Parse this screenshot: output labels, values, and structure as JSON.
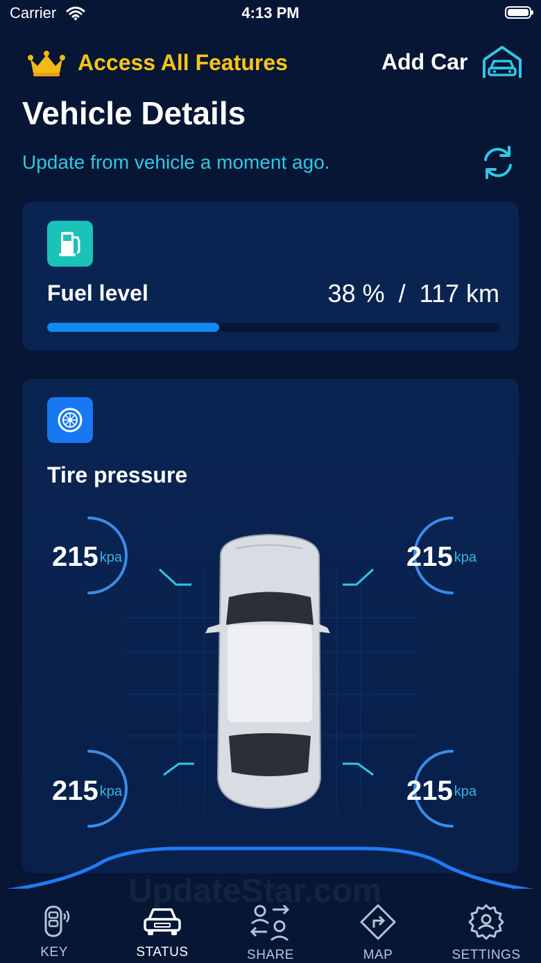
{
  "status_bar": {
    "carrier": "Carrier",
    "time": "4:13 PM"
  },
  "header": {
    "premium_label": "Access All Features",
    "add_car_label": "Add Car",
    "title": "Vehicle Details",
    "update_text": "Update from vehicle a moment ago."
  },
  "fuel": {
    "label": "Fuel level",
    "value": "38 %  /  117 km",
    "level_fraction": 0.38
  },
  "tires": {
    "label": "Tire pressure",
    "unit": "kpa",
    "front_left": "215",
    "front_right": "215",
    "rear_left": "215",
    "rear_right": "215"
  },
  "watermark": "UpdateStar.com",
  "nav": {
    "items": [
      {
        "label": "KEY",
        "icon": "car-key-icon"
      },
      {
        "label": "STATUS",
        "icon": "car-icon"
      },
      {
        "label": "SHARE",
        "icon": "share-users-icon"
      },
      {
        "label": "MAP",
        "icon": "map-direction-icon"
      },
      {
        "label": "SETTINGS",
        "icon": "settings-gear-icon"
      }
    ],
    "active_index": 1
  },
  "colors": {
    "background": "#061634",
    "card": "#0A2452",
    "premium": "#F5C518",
    "accent_cyan": "#2EC8E8",
    "fuel_bar": "#0E8BF0",
    "fuel_icon_bg": "#19C3B8",
    "tire_icon_bg": "#1877F2"
  }
}
